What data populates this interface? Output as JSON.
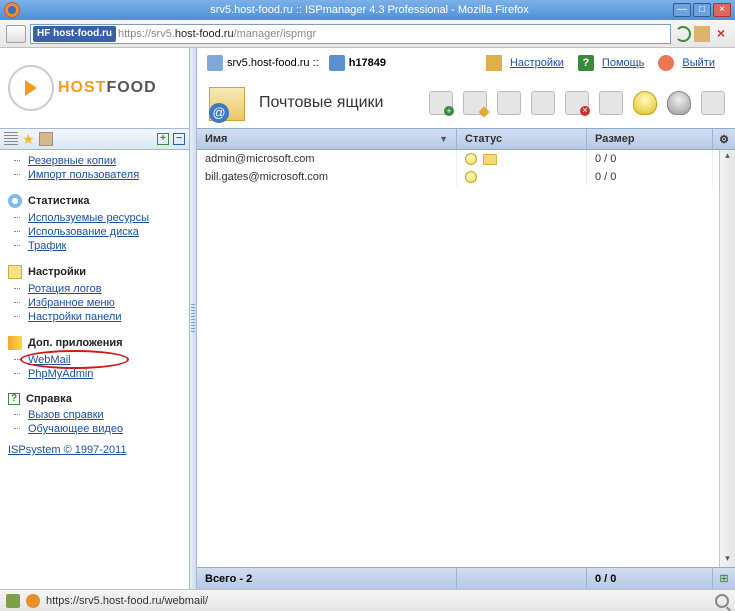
{
  "window": {
    "title": "srv5.host-food.ru :: ISPmanager 4.3 Professional - Mozilla Firefox"
  },
  "url": {
    "badge_prefix": "HF",
    "badge_host": "host-food.ru",
    "protocol": "https://",
    "dim1": "srv5.",
    "dark": "host-food.ru",
    "dim2": "/manager/ispmgr"
  },
  "logo": {
    "text_left": "HOST",
    "text_right": "FOOD"
  },
  "sidebar": {
    "top_links": [
      "Резервные копии",
      "Импорт пользователя"
    ],
    "sections": [
      {
        "title": "Статистика",
        "items": [
          "Используемые ресурсы",
          "Использование диска",
          "Трафик"
        ]
      },
      {
        "title": "Настройки",
        "items": [
          "Ротация логов",
          "Избранное меню",
          "Настройки панели"
        ]
      },
      {
        "title": "Доп. приложения",
        "items": [
          "WebMail",
          "PhpMyAdmin"
        ]
      },
      {
        "title": "Справка",
        "items": [
          "Вызов справки",
          "Обучающее видео"
        ]
      }
    ],
    "copyright": "ISPsystem © 1997-2011"
  },
  "topbar": {
    "server": "srv5.host-food.ru ::",
    "user": "h17849",
    "links": {
      "settings": "Настройки",
      "help": "Помощь",
      "exit": "Выйти"
    }
  },
  "page_title": "Почтовые ящики",
  "columns": {
    "name": "Имя",
    "status": "Статус",
    "size": "Размер"
  },
  "rows": [
    {
      "name": "admin@microsoft.com",
      "size": "0 / 0",
      "has_folder": true
    },
    {
      "name": "bill.gates@microsoft.com",
      "size": "0 / 0",
      "has_folder": false
    }
  ],
  "footer": {
    "total_label": "Всего - 2",
    "size_total": "0 / 0"
  },
  "status_url": "https://srv5.host-food.ru/webmail/"
}
